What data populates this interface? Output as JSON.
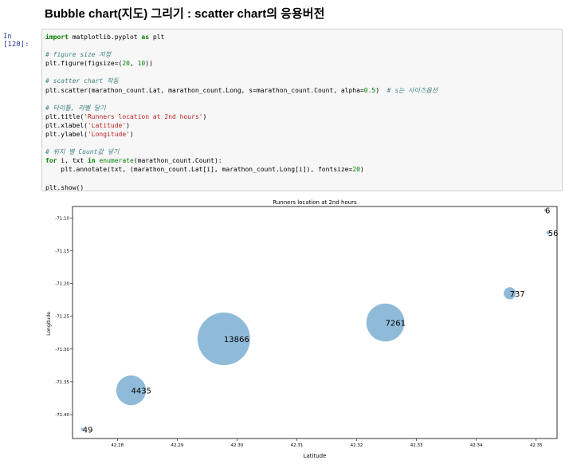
{
  "heading": "Bubble chart(지도) 그리기 : scatter chart의 응용버전",
  "prompt": "In [120]:",
  "code_lines": [
    [
      {
        "t": "import",
        "c": "kw"
      },
      {
        "t": " matplotlib.pyplot ",
        "c": ""
      },
      {
        "t": "as",
        "c": "kw"
      },
      {
        "t": " plt",
        "c": ""
      }
    ],
    [],
    [
      {
        "t": "# figure size 지정",
        "c": "cm"
      }
    ],
    [
      {
        "t": "plt.figure(figsize=(",
        "c": ""
      },
      {
        "t": "20",
        "c": "nm"
      },
      {
        "t": ", ",
        "c": ""
      },
      {
        "t": "10",
        "c": "nm"
      },
      {
        "t": "))",
        "c": ""
      }
    ],
    [],
    [
      {
        "t": "# scatter chart 작동",
        "c": "cm"
      }
    ],
    [
      {
        "t": "plt.scatter(marathon_count.Lat, marathon_count.Long, s=marathon_count.Count, alpha=",
        "c": ""
      },
      {
        "t": "0.5",
        "c": "nm"
      },
      {
        "t": ")  ",
        "c": ""
      },
      {
        "t": "# s는 사이즈옵션",
        "c": "cm"
      }
    ],
    [],
    [
      {
        "t": "# 타이틀, 라벨 달기",
        "c": "cm"
      }
    ],
    [
      {
        "t": "plt.title(",
        "c": ""
      },
      {
        "t": "'Runners location at 2nd hours'",
        "c": "st"
      },
      {
        "t": ")",
        "c": ""
      }
    ],
    [
      {
        "t": "plt.xlabel(",
        "c": ""
      },
      {
        "t": "'Latitude'",
        "c": "st"
      },
      {
        "t": ")",
        "c": ""
      }
    ],
    [
      {
        "t": "plt.ylabel(",
        "c": ""
      },
      {
        "t": "'Longitude'",
        "c": "st"
      },
      {
        "t": ")",
        "c": ""
      }
    ],
    [],
    [
      {
        "t": "# 위치 별 Count값 넣기",
        "c": "cm"
      }
    ],
    [
      {
        "t": "for",
        "c": "kw"
      },
      {
        "t": " i, txt ",
        "c": ""
      },
      {
        "t": "in",
        "c": "kw"
      },
      {
        "t": " ",
        "c": ""
      },
      {
        "t": "enumerate",
        "c": "nm"
      },
      {
        "t": "(marathon_count.Count):",
        "c": ""
      }
    ],
    [
      {
        "t": "    plt.annotate(txt, (marathon_count.Lat[i], marathon_count.Long[i]), fontsize=",
        "c": ""
      },
      {
        "t": "20",
        "c": "nm"
      },
      {
        "t": ")",
        "c": ""
      }
    ],
    [],
    [
      {
        "t": "plt.show()",
        "c": ""
      }
    ]
  ],
  "chart_data": {
    "type": "scatter",
    "title": "Runners location at 2nd hours",
    "xlabel": "Latitude",
    "ylabel": "Longitude",
    "xlim": [
      42.2725,
      42.3535
    ],
    "ylim": [
      -71.4365,
      -71.0825
    ],
    "xticks": [
      42.28,
      42.29,
      42.3,
      42.31,
      42.32,
      42.33,
      42.34,
      42.35
    ],
    "xtick_labels": [
      "42.28",
      "42.29",
      "42.30",
      "42.31",
      "42.32",
      "42.33",
      "42.34",
      "42.35"
    ],
    "yticks": [
      -71.1,
      -71.15,
      -71.2,
      -71.25,
      -71.3,
      -71.35,
      -71.4
    ],
    "ytick_labels": [
      "-71.10",
      "-71.15",
      "-71.20",
      "-71.25",
      "-71.30",
      "-71.35",
      "-71.40"
    ],
    "color": "#1f77b4",
    "alpha": 0.5,
    "points": [
      {
        "x": 42.2742,
        "y": -71.4225,
        "count": 49,
        "label": "49"
      },
      {
        "x": 42.2823,
        "y": -71.363,
        "count": 4435,
        "label": "4435"
      },
      {
        "x": 42.2978,
        "y": -71.2845,
        "count": 13866,
        "label": "13866"
      },
      {
        "x": 42.3248,
        "y": -71.2595,
        "count": 7261,
        "label": "7261"
      },
      {
        "x": 42.3456,
        "y": -71.215,
        "count": 737,
        "label": "737"
      },
      {
        "x": 42.352,
        "y": -71.1225,
        "count": 56,
        "label": "56"
      },
      {
        "x": 42.3515,
        "y": -71.088,
        "count": 6,
        "label": "6"
      }
    ]
  }
}
